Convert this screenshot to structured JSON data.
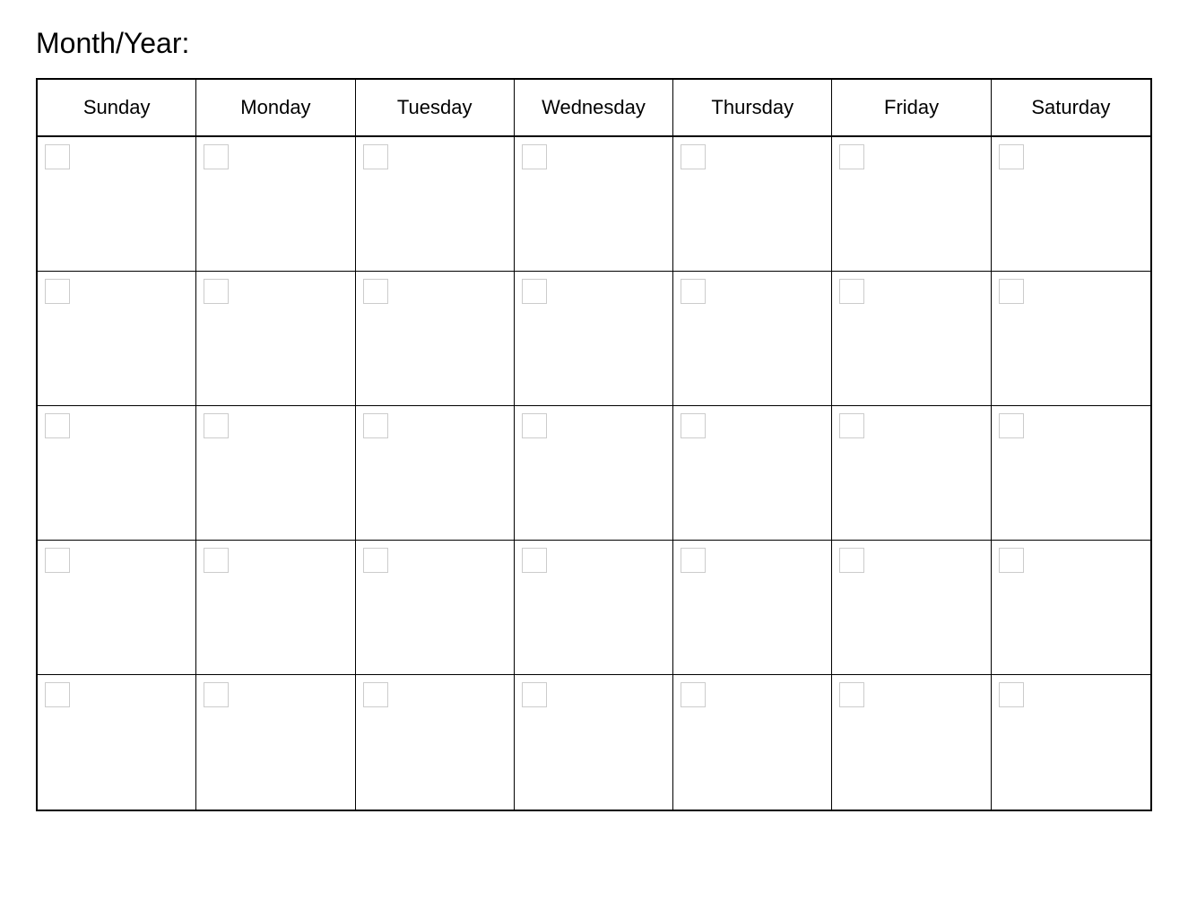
{
  "header": {
    "title": "Month/Year:"
  },
  "calendar": {
    "days": [
      "Sunday",
      "Monday",
      "Tuesday",
      "Wednesday",
      "Thursday",
      "Friday",
      "Saturday"
    ],
    "rows": 5
  }
}
